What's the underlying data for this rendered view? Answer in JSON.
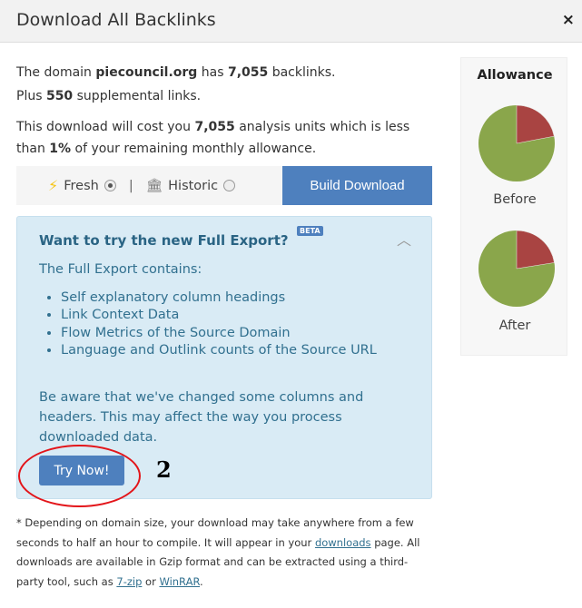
{
  "dialog": {
    "title": "Download All Backlinks",
    "close": "×"
  },
  "summary": {
    "line1_a": "The domain ",
    "domain": "piecouncil.org",
    "line1_b": " has ",
    "backlinks": "7,055",
    "line1_c": " backlinks.",
    "line2_a": "Plus ",
    "supplemental": "550",
    "line2_b": " supplemental links.",
    "line3_a": "This download will cost you ",
    "units": "7,055",
    "line3_b": " analysis units which is less than ",
    "percent": "1%",
    "line3_c": " of your remaining monthly allowance."
  },
  "options": {
    "fresh": "Fresh",
    "separator": "|",
    "historic": "Historic",
    "selected": "fresh",
    "build": "Build Download"
  },
  "panel": {
    "heading": "Want to try the new Full Export?",
    "badge": "BETA",
    "intro": "The Full Export contains:",
    "items": [
      "Self explanatory column headings",
      "Link Context Data",
      "Flow Metrics of the Source Domain",
      "Language and Outlink counts of the Source URL"
    ],
    "warning": "Be aware that we've changed some columns and headers. This may affect the way you process downloaded data.",
    "try": "Try Now!"
  },
  "annotation": {
    "number": "2",
    "color": "#e3151a"
  },
  "footer": {
    "a": "* Depending on domain size, your download may take anywhere from a few seconds to half an hour to compile. It will appear in your ",
    "downloads": "downloads",
    "b": " page. All downloads are available in Gzip format and can be extracted using a third-party tool, such as ",
    "zip": "7-zip",
    "c": " or ",
    "winrar": "WinRAR",
    "d": "."
  },
  "allowance": {
    "title": "Allowance",
    "colors": {
      "used": "#a94442",
      "remaining": "#8aa64b"
    },
    "before": {
      "label": "Before",
      "used_fraction": 0.22
    },
    "after": {
      "label": "After",
      "used_fraction": 0.225
    }
  }
}
